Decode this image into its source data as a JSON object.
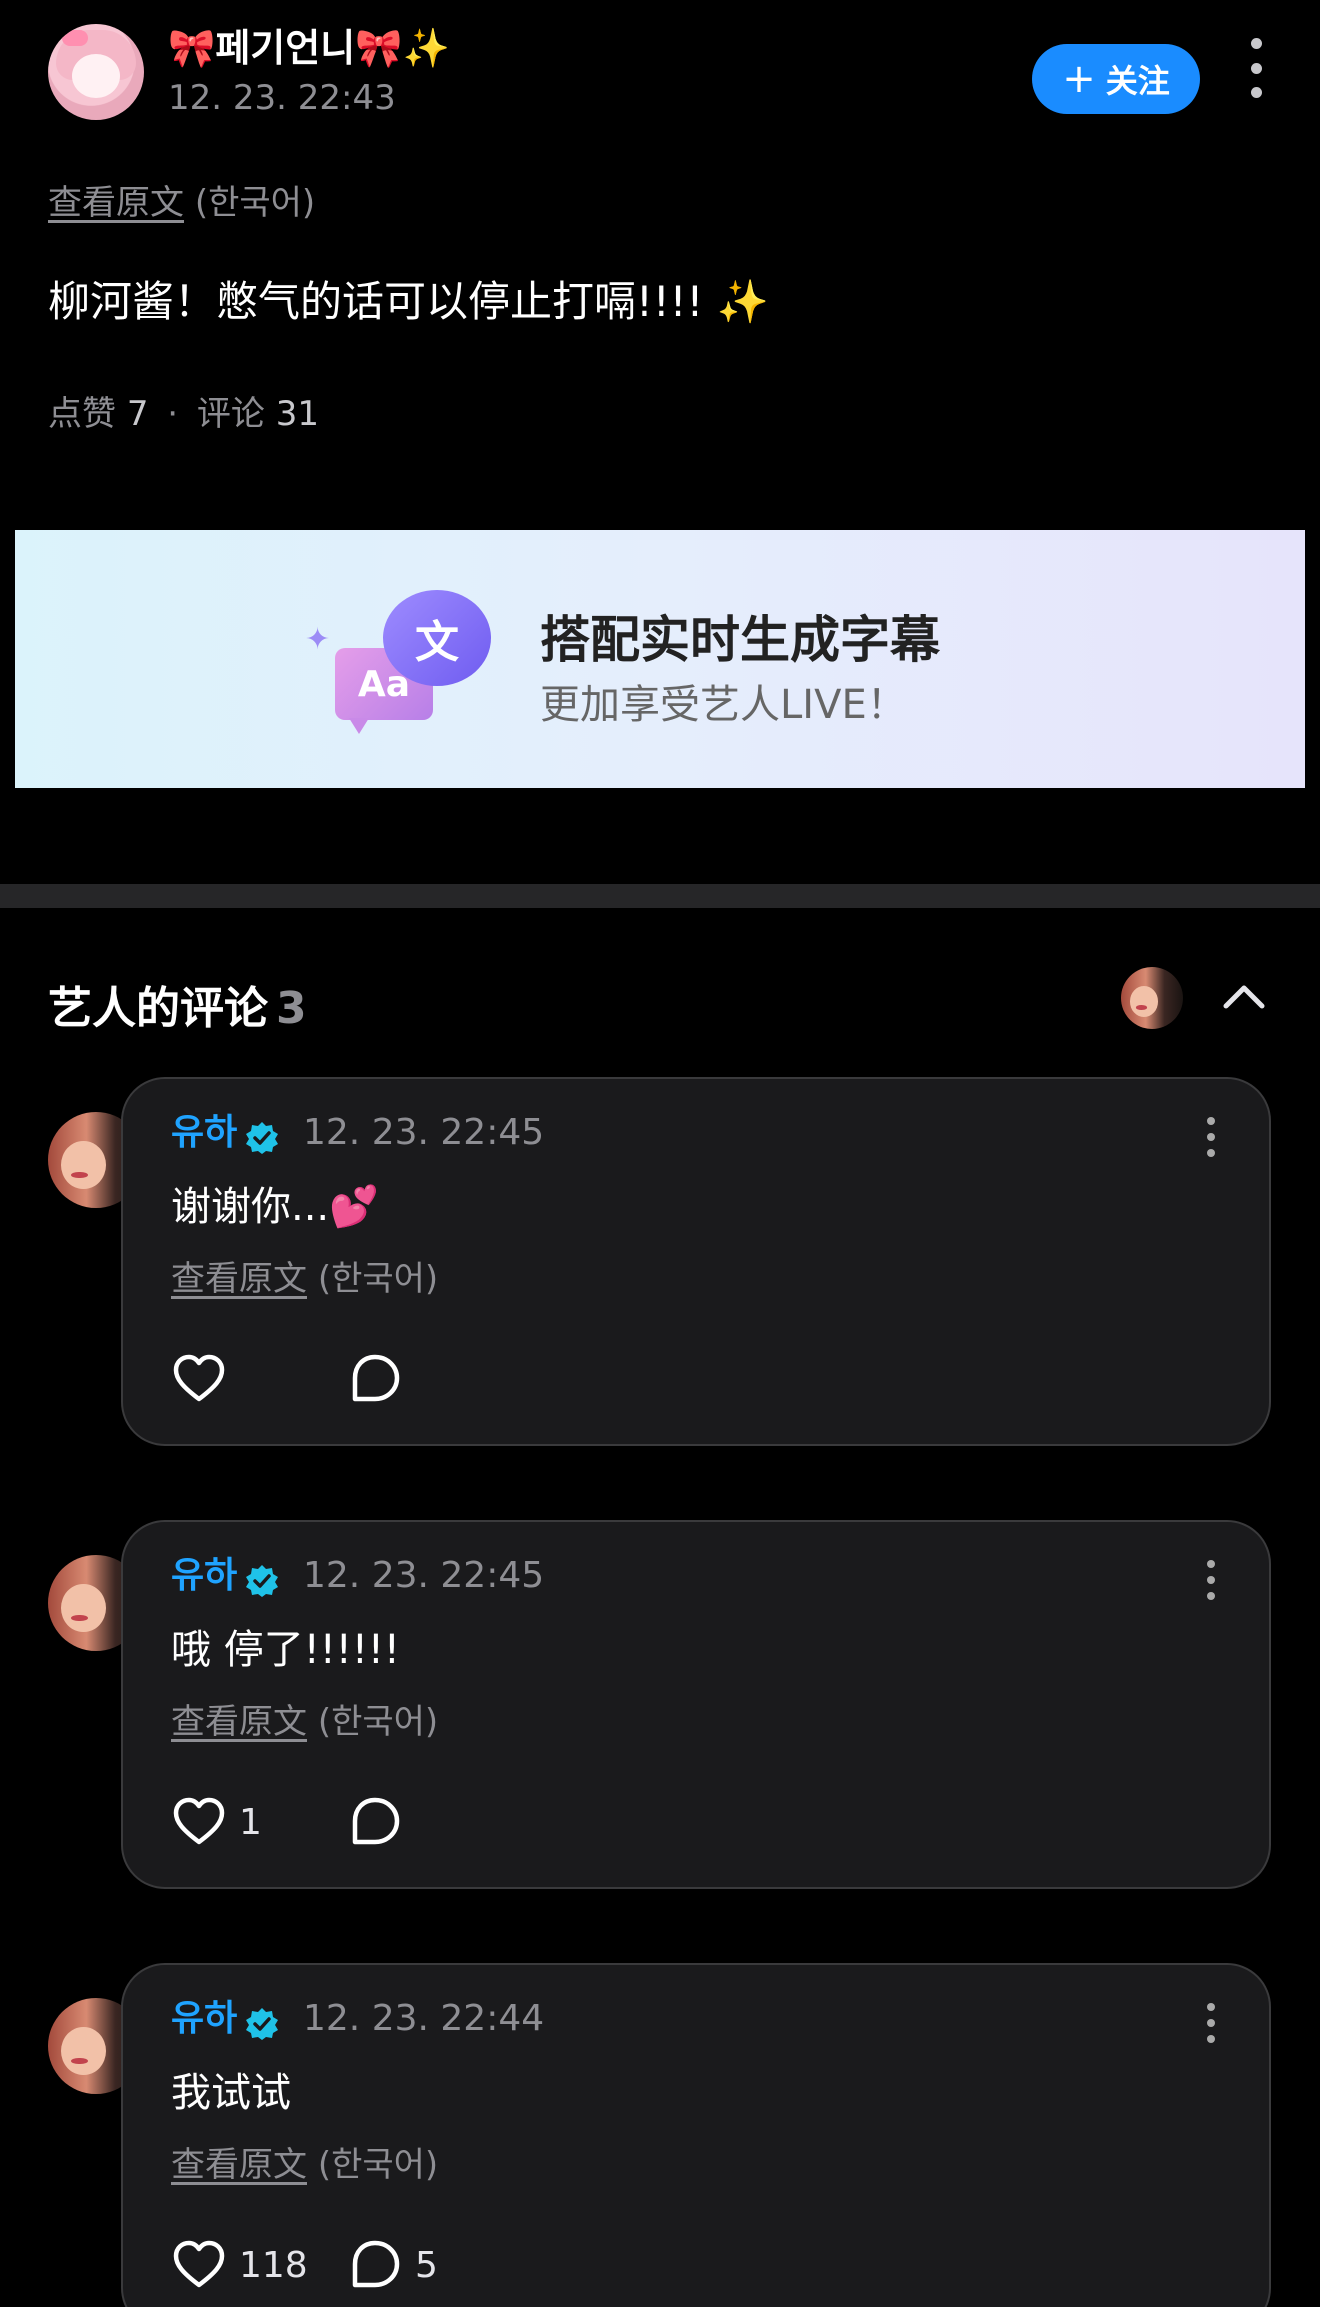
{
  "post": {
    "author": {
      "bow_left": "🎀",
      "name": "페기언니",
      "bow_right": "🎀",
      "sparkle": "✨"
    },
    "time": "12. 23. 22:43",
    "follow_label": "关注",
    "translate": {
      "link": "查看原文",
      "lang": "(한국어)"
    },
    "text": "柳河酱！憋气的话可以停止打嗝!!!!",
    "text_emoji": "✨",
    "stats": {
      "likes_label": "点赞",
      "likes": "7",
      "separator": "·",
      "comments_label": "评论",
      "comments": "31"
    }
  },
  "banner": {
    "icon_text_small": "Aa",
    "icon_text_big": "文",
    "title": "搭配实时生成字幕",
    "subtitle": "更加享受艺人LIVE！"
  },
  "artist_comments": {
    "title": "艺人的评论",
    "count": "3",
    "items": [
      {
        "name": "유하",
        "time": "12. 23. 22:45",
        "text": "谢谢你...",
        "emoji": "💕",
        "translate": {
          "link": "查看原文",
          "lang": "(한국어)"
        },
        "likes": "",
        "replies": ""
      },
      {
        "name": "유하",
        "time": "12. 23. 22:45",
        "text": "哦 停了!!!!!!",
        "emoji": "",
        "translate": {
          "link": "查看原文",
          "lang": "(한국어)"
        },
        "likes": "1",
        "replies": ""
      },
      {
        "name": "유하",
        "time": "12. 23. 22:44",
        "text": "我试试",
        "emoji": "",
        "translate": {
          "link": "查看原文",
          "lang": "(한국어)"
        },
        "likes": "118",
        "replies": "5"
      }
    ]
  },
  "colors": {
    "accent": "#1a8cff",
    "artist_name": "#1fa3ff",
    "verified": "#1fc2e8",
    "card_bg": "#1a1a1c",
    "muted_text": "#8e8e93"
  },
  "icons": [
    "more-vertical-icon",
    "plus-icon",
    "chevron-up-icon",
    "verified-badge-icon",
    "heart-outline-icon",
    "reply-bubble-icon"
  ]
}
